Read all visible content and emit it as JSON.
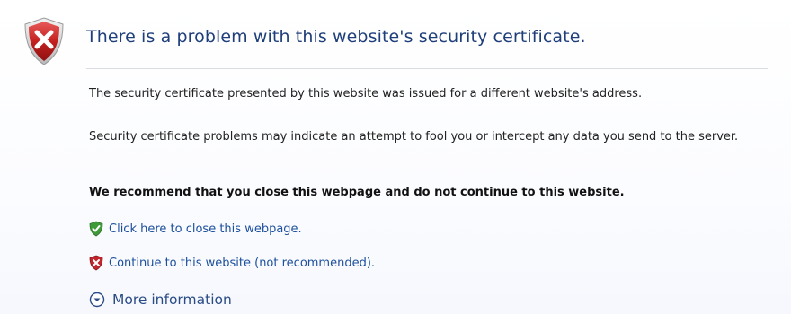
{
  "header": {
    "title": "There is a problem with this website's security certificate."
  },
  "body": {
    "paragraph1": "The security certificate presented by this website was issued for a different website's address.",
    "paragraph2": "Security certificate problems may indicate an attempt to fool you or intercept any data you send to the server.",
    "recommendation": "We recommend that you close this webpage and do not continue to this website."
  },
  "links": {
    "close_label": "Click here to close this webpage.",
    "continue_label": "Continue to this website (not recommended).",
    "more_info_label": "More information"
  },
  "icons": {
    "header": "shield-error-icon",
    "close": "shield-check-icon",
    "continue": "shield-x-icon",
    "more_info": "chevron-circle-down-icon"
  },
  "colors": {
    "title": "#1f3f7a",
    "link": "#1c4f9c",
    "error_red": "#c0262c",
    "safe_green": "#3f9b3a"
  }
}
